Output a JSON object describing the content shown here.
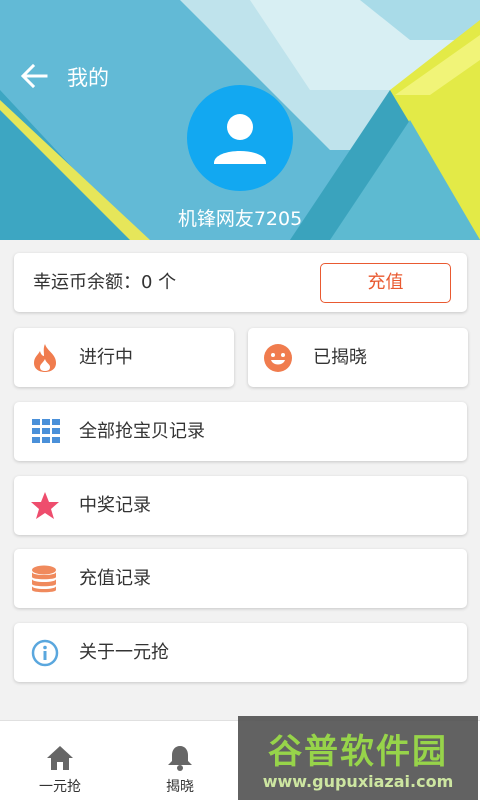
{
  "header": {
    "title": "我的",
    "username": "机锋网友7205"
  },
  "balance": {
    "label": "幸运币余额：0 个",
    "recharge_label": "充值"
  },
  "menu": {
    "ongoing": "进行中",
    "revealed": "已揭晓",
    "all_records": "全部抢宝贝记录",
    "win_records": "中奖记录",
    "recharge_records": "充值记录",
    "about": "关于一元抢"
  },
  "tabs": [
    "一元抢",
    "揭晓",
    "",
    ""
  ],
  "watermark": {
    "brand": "谷普软件园",
    "url": "www.gupuxiazai.com"
  },
  "colors": {
    "accent": "#e95a31",
    "avatar": "#12a8f1",
    "star": "#ee4d6d",
    "grid": "#4a90d9",
    "coin": "#f08a5d",
    "info": "#5aa7de",
    "flame": "#f07c4e"
  }
}
